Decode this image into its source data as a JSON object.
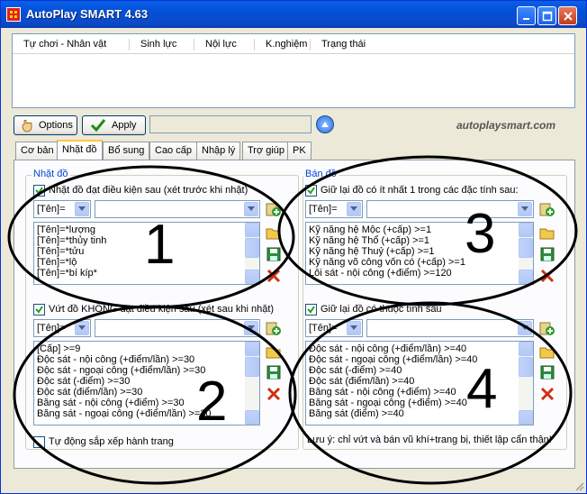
{
  "window": {
    "title": "AutoPlay SMART 4.63"
  },
  "titlebar_buttons": [
    "minimize-icon",
    "maximize-icon",
    "close-icon"
  ],
  "list_headers": [
    "Tự chơi - Nhân vật",
    "Sinh lực",
    "Nội lực",
    "K.nghiệm",
    "Trạng thái"
  ],
  "toolbar": {
    "options_label": "Options",
    "apply_label": "Apply",
    "brand": "autoplaysmart.com"
  },
  "tabs": [
    "Cơ bản",
    "Nhặt đồ",
    "Bổ sung",
    "Cao cấp",
    "Nhập lý",
    "Trợ giúp",
    "PK"
  ],
  "active_tab": "Nhặt đồ",
  "pickup": {
    "group_label": "Nhặt đồ",
    "check_label": "Nhặt đồ đạt điều kiện sau (xét trước khi nhặt)",
    "combo_value": "[Tên]=",
    "items": [
      "[Tên]=*lượng",
      "[Tên]=*thủy tinh",
      "[Tên]=*tửu",
      "[Tên]=*lộ",
      "[Tên]=*bí kíp*"
    ]
  },
  "discard": {
    "check_label": "Vứt đồ KHÔNG đạt điều kiện sau (xét sau khi nhặt)",
    "combo_value": "[Tên]=",
    "items": [
      "[Cấp] >=9",
      "Độc sát - nội công (+điểm/lần) >=30",
      "Độc sát - ngoại công (+điểm/lần) >=30",
      "Độc sát (-điểm) >=30",
      "Độc sát (điểm/lần) >=30",
      "Băng sát - nội công (+điểm) >=30",
      "Băng sát - ngoại công (+điểm/lần) >=30"
    ],
    "auto_sort_label": "Tự động sắp xếp hành trang"
  },
  "sell": {
    "group_label": "Bán đồ",
    "check_label": "Giữ lại đồ có ít nhất 1 trong các đặc tính sau:",
    "combo_value": "[Tên]=",
    "items": [
      "Kỹ năng hệ Mộc (+cấp) >=1",
      "Kỹ năng hệ Thổ (+cấp) >=1",
      "Kỹ năng hệ Thuỷ (+cấp) >=1",
      "Kỹ năng võ công vốn có (+cấp) >=1",
      "Lôi sát - nội công (+điểm) >=120"
    ]
  },
  "keep": {
    "check_label": "Giữ lại đồ có thuộc tính sau",
    "combo_value": "[Tên]=",
    "items": [
      "Độc sát - nội công (+điểm/lần) >=40",
      "Độc sát - ngoại công (+điểm/lần) >=40",
      "Độc sát (-điểm) >=40",
      "Độc sát (điểm/lần) >=40",
      "Băng sát - nội công (+điểm) >=40",
      "Băng sát - ngoại công (+điểm) >=40",
      "Băng sát (điểm) >=40"
    ]
  },
  "note": "Lưu ý: chỉ vứt và bán vũ khí+trang bị, thiết lập cẩn thận!",
  "annotations": [
    "1",
    "2",
    "3",
    "4"
  ],
  "colors": {
    "titlebar": "#0A5FE8",
    "window_bg": "#ECE9D8",
    "group_label": "#0046D5",
    "add_icon": "#2e9b2e",
    "delete_icon": "#d03010"
  }
}
